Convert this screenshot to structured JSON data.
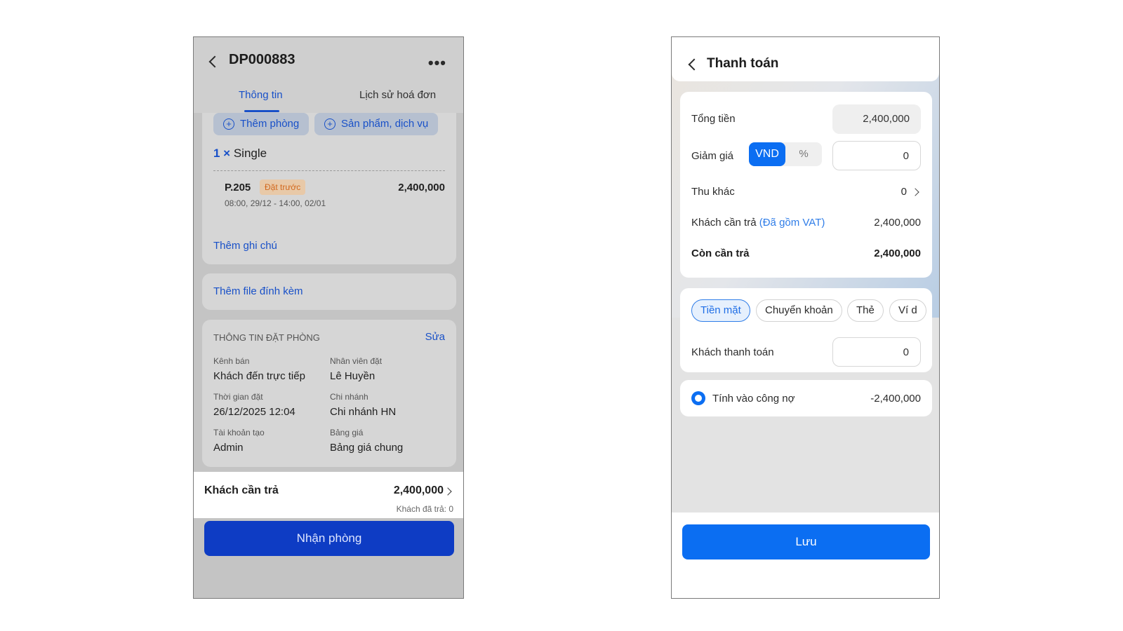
{
  "left_screen": {
    "booking_code": "DP000883",
    "tabs": [
      "Thông tin",
      "Lịch sử hoá đơn"
    ],
    "add_room_label": "Thêm phòng",
    "add_service_label": "Sản phẩm, dịch vụ",
    "room_type_qty": "1 ×",
    "room_type": "Single",
    "room_no": "P.205",
    "room_badge": "Đặt trước",
    "room_price": "2,400,000",
    "room_time": "08:00, 29/12 - 14:00, 02/01",
    "add_note": "Thêm ghi chú",
    "add_file": "Thêm file đính kèm",
    "info_title": "THÔNG TIN ĐẶT PHÒNG",
    "info_edit": "Sửa",
    "info_fields": [
      {
        "label": "Kênh bán",
        "value": "Khách đến trực tiếp"
      },
      {
        "label": "Nhân viên đặt",
        "value": "Lê Huyền"
      },
      {
        "label": "Thời gian đặt",
        "value": "26/12/2025 12:04"
      },
      {
        "label": "Chi nhánh",
        "value": "Chi nhánh HN"
      },
      {
        "label": "Tài khoản tạo",
        "value": "Admin"
      },
      {
        "label": "Bảng giá",
        "value": "Bảng giá chung"
      }
    ],
    "customer_pay_label": "Khách cần trả",
    "customer_pay_value": "2,400,000",
    "customer_paid": "Khách đã trả: 0",
    "checkin_button": "Nhận phòng"
  },
  "right_screen": {
    "title": "Thanh toán",
    "total_label": "Tổng tiền",
    "total_value": "2,400,000",
    "discount_label": "Giảm giá",
    "discount_modes": [
      "VND",
      "%"
    ],
    "discount_value": "0",
    "other_label": "Thu khác",
    "other_value": "0",
    "customer_pay_label": "Khách cần trả",
    "vat_note": "(Đã gồm VAT)",
    "customer_pay_value": "2,400,000",
    "remaining_label": "Còn cần trả",
    "remaining_value": "2,400,000",
    "payment_methods": [
      "Tiền mặt",
      "Chuyển khoản",
      "Thẻ",
      "Ví d"
    ],
    "customer_payment_label": "Khách thanh toán",
    "customer_payment_value": "0",
    "debt_label": "Tính vào công nợ",
    "debt_value": "-2,400,000",
    "save_button": "Lưu"
  },
  "colors": {
    "left_accent": "#1850c8",
    "left_primary_button": "#0e3cc4",
    "right_accent": "#0b6ef2",
    "badge_text": "#d2691e"
  }
}
